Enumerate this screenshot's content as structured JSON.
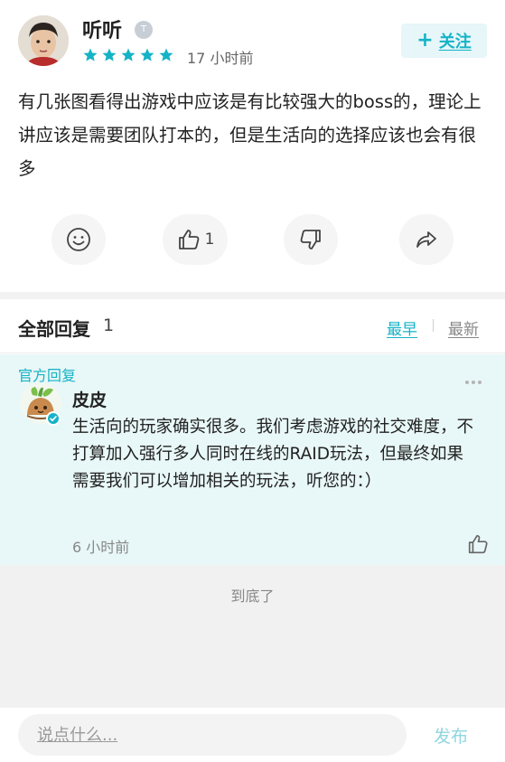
{
  "post": {
    "author": "听听",
    "level_badge": "T",
    "rating": 5,
    "time": "17 小时前",
    "follow_label": "关注",
    "body": "有几张图看得出游戏中应该是有比较强大的boss的，理论上讲应该是需要团队打本的，但是生活向的选择应该也会有很多",
    "actions": {
      "like_count": "1"
    }
  },
  "replies": {
    "title": "全部回复",
    "count": "1",
    "sort_earliest": "最早",
    "sort_newest": "最新",
    "items": [
      {
        "tag": "官方回复",
        "name": "皮皮",
        "body": "生活向的玩家确实很多。我们考虑游戏的社交难度，不打算加入强行多人同时在线的RAID玩法，但最终如果需要我们可以增加相关的玩法，听您的：）",
        "time": "6 小时前"
      }
    ]
  },
  "footer": {
    "end_text": "到底了",
    "input_placeholder": "说点什么...",
    "send_label": "发布"
  },
  "colors": {
    "accent": "#15b3c6",
    "reply_bg": "#e8f7f7"
  }
}
